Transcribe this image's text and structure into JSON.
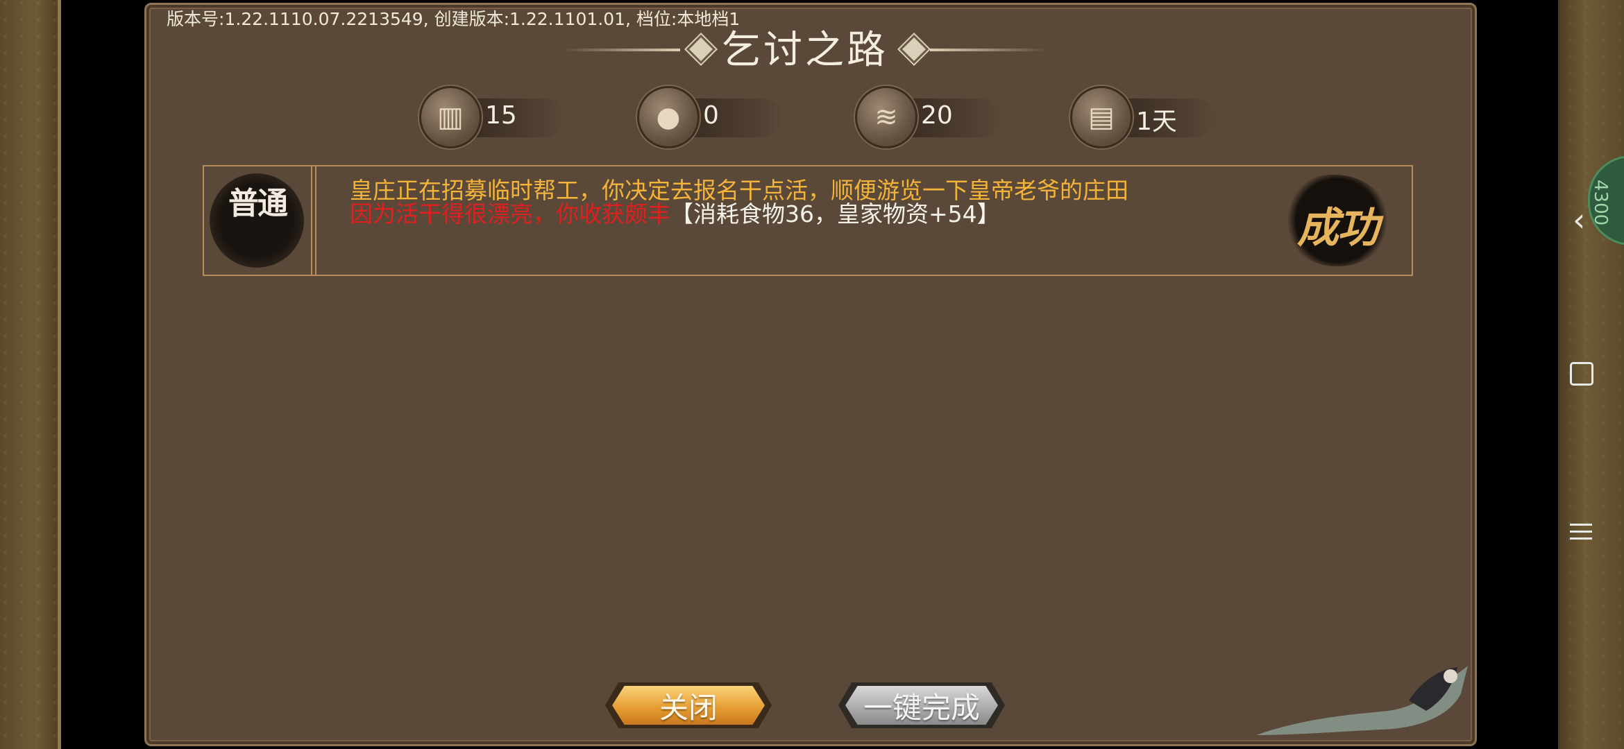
{
  "version_info": "版本号:1.22.1110.07.2213549, 创建版本:1.22.1101.01, 档位:本地档1",
  "title": "乞讨之路",
  "resources": [
    {
      "icon": "scroll-icon",
      "value": "15"
    },
    {
      "icon": "buns-icon",
      "value": "0"
    },
    {
      "icon": "bandage-icon",
      "value": "20"
    },
    {
      "icon": "book-icon",
      "value": "1天"
    }
  ],
  "event": {
    "difficulty": "普通",
    "line1": "皇庄正在招募临时帮工，你决定去报名干点活，顺便游览一下皇帝老爷的庄田",
    "line2_red": "因为活干得很漂亮，你收获颇丰",
    "line2_white": "【消耗食物36，皇家物资+54】",
    "result": "成功"
  },
  "buttons": {
    "close": "关闭",
    "auto_complete": "一键完成"
  },
  "overlay_bubble": "4300",
  "colors": {
    "panel": "#5a4838",
    "event_text": "#f4b43a",
    "event_red": "#e02020",
    "close_button": "#e49a2e"
  }
}
